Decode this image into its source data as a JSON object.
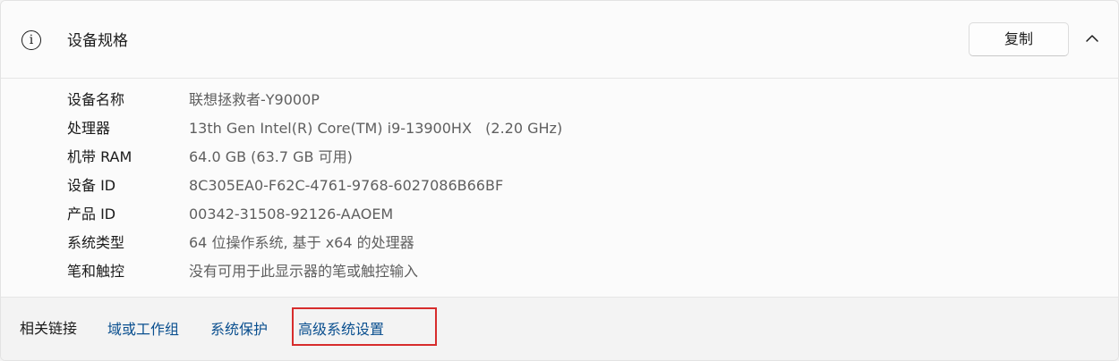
{
  "header": {
    "title": "设备规格",
    "copy_label": "复制",
    "info_icon": "info-icon",
    "collapse_icon": "chevron-up-icon"
  },
  "specs": [
    {
      "label": "设备名称",
      "value": "联想拯救者-Y9000P"
    },
    {
      "label": "处理器",
      "value": "13th Gen Intel(R) Core(TM) i9-13900HX   (2.20 GHz)"
    },
    {
      "label": "机带 RAM",
      "value": "64.0 GB (63.7 GB 可用)"
    },
    {
      "label": "设备 ID",
      "value": "8C305EA0-F62C-4761-9768-6027086B66BF"
    },
    {
      "label": "产品 ID",
      "value": "00342-31508-92126-AAOEM"
    },
    {
      "label": "系统类型",
      "value": "64 位操作系统, 基于 x64 的处理器"
    },
    {
      "label": "笔和触控",
      "value": "没有可用于此显示器的笔或触控输入"
    }
  ],
  "footer": {
    "label": "相关链接",
    "links": [
      "域或工作组",
      "系统保护",
      "高级系统设置"
    ]
  },
  "colors": {
    "link": "#0a4f8f",
    "highlight": "#d72c2c",
    "secondary_text": "#5f5f5f"
  }
}
